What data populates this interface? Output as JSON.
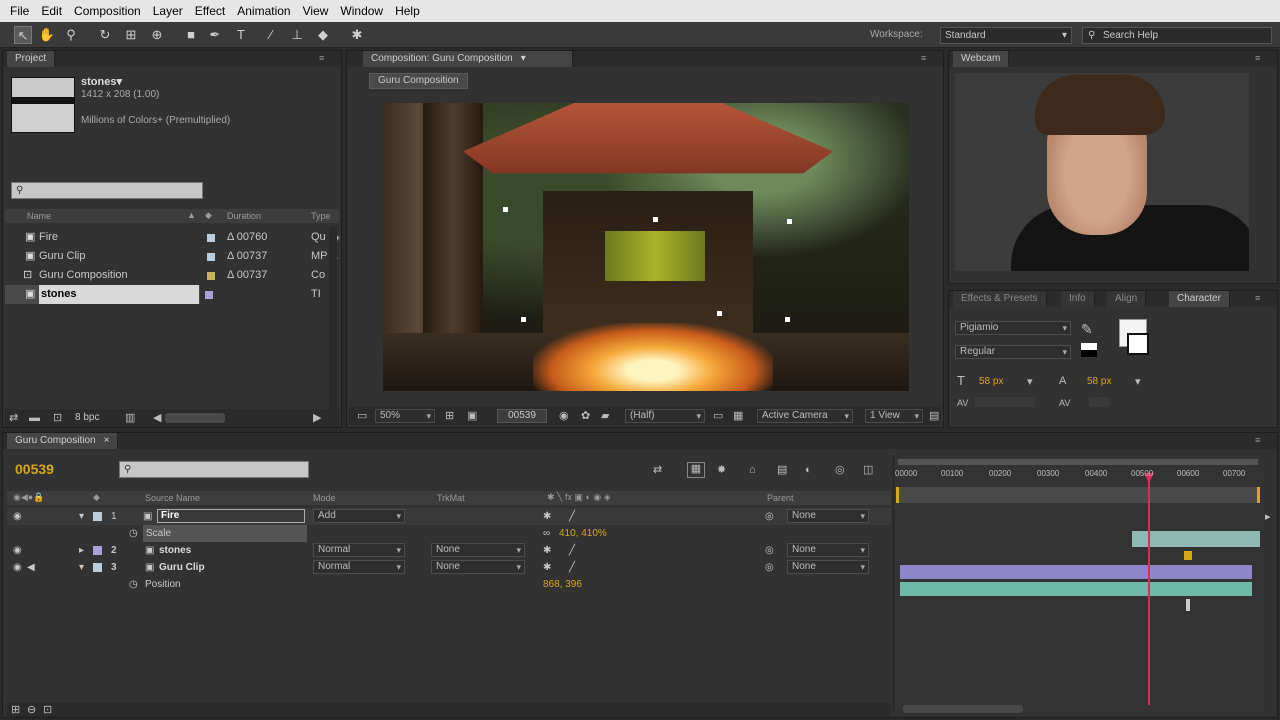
{
  "menu": [
    "File",
    "Edit",
    "Composition",
    "Layer",
    "Effect",
    "Animation",
    "View",
    "Window",
    "Help"
  ],
  "toolbar": {
    "workspace_label": "Workspace:",
    "workspace_value": "Standard",
    "search_placeholder": "Search Help"
  },
  "project": {
    "tab": "Project",
    "selected_name": "stones▾",
    "selected_dims": "1412 x 208 (1.00)",
    "selected_colors": "Millions of Colors+ (Premultiplied)",
    "columns": {
      "name": "Name",
      "duration": "Duration",
      "type": "Type"
    },
    "items": [
      {
        "name": "Fire",
        "duration": "Δ 00760",
        "type": "Qu"
      },
      {
        "name": "Guru Clip",
        "duration": "Δ 00737",
        "type": "MP"
      },
      {
        "name": "Guru Composition",
        "duration": "Δ 00737",
        "type": "Co"
      },
      {
        "name": "stones",
        "duration": "",
        "type": "TI"
      }
    ],
    "bpc": "8 bpc"
  },
  "composition": {
    "tab": "Composition: Guru Composition",
    "subtab": "Guru Composition",
    "zoom": "50%",
    "timecode": "00539",
    "resolution": "(Half)",
    "camera": "Active Camera",
    "views": "1 View"
  },
  "webcam": {
    "tab": "Webcam"
  },
  "character": {
    "tabs": [
      "Effects & Presets",
      "Info",
      "Align",
      "Character"
    ],
    "font": "Pigiamio",
    "style": "Regular",
    "size": "58 px",
    "leading": "58 px"
  },
  "timeline": {
    "tab": "Guru Composition",
    "timecode": "00539",
    "columns": {
      "source": "Source Name",
      "mode": "Mode",
      "trkmat": "TrkMat",
      "parent": "Parent"
    },
    "ruler": [
      "00000",
      "00100",
      "00200",
      "00300",
      "00400",
      "00500",
      "00600",
      "00700"
    ],
    "layers": [
      {
        "num": "1",
        "name": "Fire",
        "mode": "Add",
        "trkmat": "",
        "parent": "None"
      },
      {
        "num": "2",
        "name": "stones",
        "mode": "Normal",
        "trkmat": "None",
        "parent": "None"
      },
      {
        "num": "3",
        "name": "Guru Clip",
        "mode": "Normal",
        "trkmat": "None",
        "parent": "None"
      }
    ],
    "props": [
      {
        "name": "Scale",
        "value": "410, 410%"
      },
      {
        "name": "Position",
        "value": "868, 396"
      }
    ],
    "colors": {
      "playhead": "#e8265a",
      "fire_bar": "#9fd0c8",
      "stones_bar": "#8f86c9",
      "clip_bar": "#6fb8a8",
      "accent": "#d7a61a"
    }
  }
}
